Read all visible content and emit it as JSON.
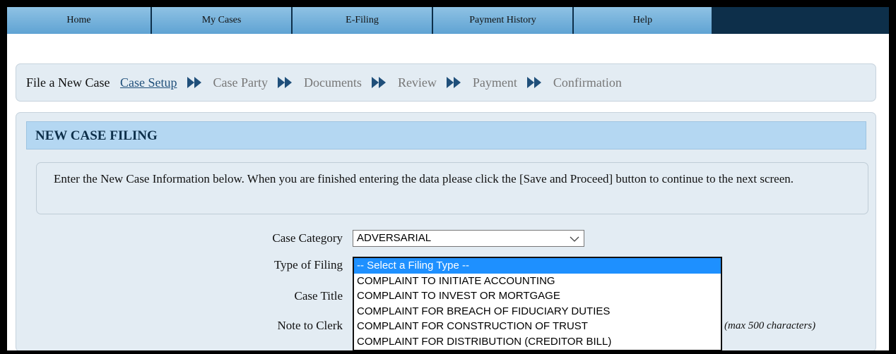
{
  "nav": {
    "items": [
      "Home",
      "My Cases",
      "E-Filing",
      "Payment History",
      "Help"
    ]
  },
  "wizard": {
    "label": "File a New Case",
    "steps": [
      "Case Setup",
      "Case Party",
      "Documents",
      "Review",
      "Payment",
      "Confirmation"
    ],
    "active_step": "Case Setup"
  },
  "panel": {
    "title": "NEW CASE FILING",
    "instructions": "Enter the New Case Information below. When you are finished entering the data please click the [Save and Proceed] button to continue to the next screen."
  },
  "form": {
    "case_category_label": "Case Category",
    "case_category_value": "ADVERSARIAL",
    "type_of_filing_label": "Type of Filing",
    "case_title_label": "Case Title",
    "note_to_clerk_label": "Note to Clerk",
    "note_hint": "(max 500 characters)",
    "filing_type_options": [
      "-- Select a Filing Type --",
      "COMPLAINT TO INITIATE ACCOUNTING",
      "COMPLAINT TO INVEST OR MORTGAGE",
      "COMPLAINT FOR BREACH OF FIDUCIARY DUTIES",
      "COMPLAINT FOR CONSTRUCTION OF TRUST",
      "COMPLAINT FOR DISTRIBUTION (CREDITOR BILL)"
    ],
    "filing_type_selected_index": 0
  },
  "colors": {
    "nav_bg": "#0d2f4a",
    "nav_tab": "#7db6de",
    "panel_bg": "#e3ecf3",
    "header_bg": "#b4d7f2",
    "arrow": "#1f4f7a",
    "option_highlight": "#1e90ff"
  }
}
